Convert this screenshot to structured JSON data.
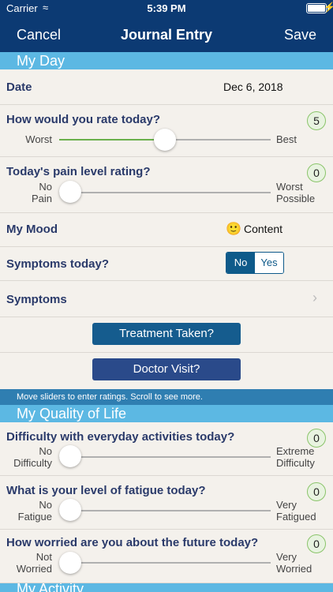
{
  "status": {
    "carrier": "Carrier",
    "time": "5:39 PM"
  },
  "nav": {
    "cancel": "Cancel",
    "title": "Journal Entry",
    "save": "Save"
  },
  "sections": {
    "my_day": "My Day",
    "quality": "My Quality of Life",
    "activity": "My Activity"
  },
  "date": {
    "label": "Date",
    "value": "Dec 6, 2018"
  },
  "rating": {
    "question": "How would you rate today?",
    "value": "5",
    "left": "Worst",
    "right": "Best",
    "level": 0.5
  },
  "pain": {
    "question": "Today's pain level rating?",
    "value": "0",
    "left": "No Pain",
    "right": "Worst Possible"
  },
  "mood": {
    "label": "My Mood",
    "emoji": "🙂",
    "value": "Content"
  },
  "symptoms_today": {
    "label": "Symptoms today?",
    "no": "No",
    "yes": "Yes",
    "selected": "No"
  },
  "symptoms": {
    "label": "Symptoms"
  },
  "buttons": {
    "treatment": "Treatment Taken?",
    "doctor": "Doctor Visit?"
  },
  "hint": "Move sliders to enter ratings. Scroll to see more.",
  "difficulty": {
    "question": "Difficulty with everyday activities today?",
    "value": "0",
    "left_1": "No",
    "left_2": "Difficulty",
    "right_1": "Extreme",
    "right_2": "Difficulty"
  },
  "fatigue": {
    "question": "What is your level of fatigue today?",
    "value": "0",
    "left_1": "No",
    "left_2": "Fatigue",
    "right_1": "Very",
    "right_2": "Fatigued"
  },
  "worried": {
    "question": "How worried are you about the future today?",
    "value": "0",
    "left_1": "Not",
    "left_2": "Worried",
    "right_1": "Very",
    "right_2": "Worried"
  },
  "pain_labels": {
    "left_1": "No",
    "left_2": "Pain",
    "right_1": "Worst",
    "right_2": "Possible"
  },
  "colors": {
    "nav": "#0c3a73",
    "section": "#5cb8e3",
    "accent": "#0e5a8a",
    "slider_fill": "#6ab04c"
  }
}
